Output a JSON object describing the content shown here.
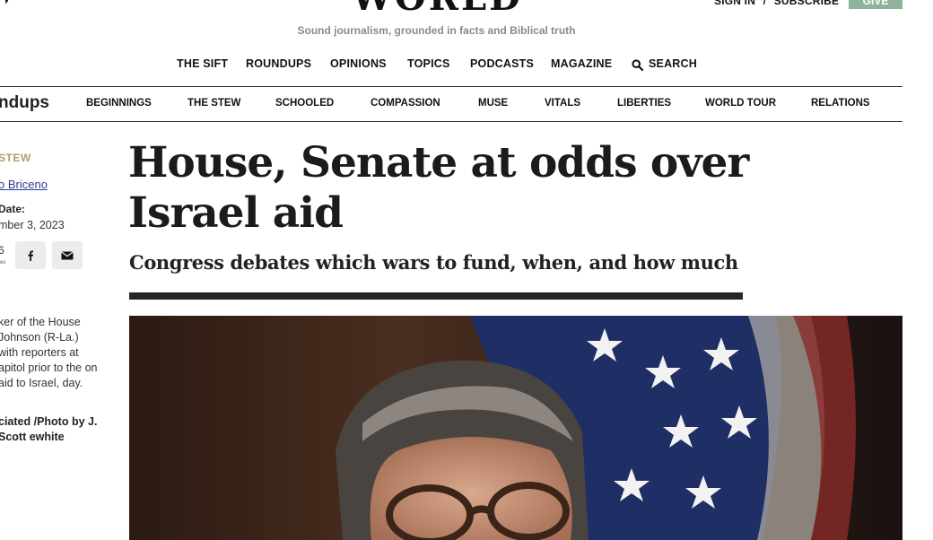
{
  "header": {
    "logo_text": "WORLD",
    "tagline": "Sound journalism, grounded in facts and Biblical truth",
    "sign_in": "SIGN IN",
    "separator": "/",
    "subscribe": "SUBSCRIBE",
    "give": "GIVE",
    "give_color": "#8fb29b"
  },
  "main_nav": [
    {
      "label": "THE SIFT"
    },
    {
      "label": "ROUNDUPS"
    },
    {
      "label": "OPINIONS"
    },
    {
      "label": "TOPICS"
    },
    {
      "label": "PODCASTS"
    },
    {
      "label": "MAGAZINE"
    },
    {
      "label": "SEARCH",
      "icon": "search-icon"
    }
  ],
  "sub_nav": {
    "brand": "ndups",
    "items": [
      {
        "label": "BEGINNINGS"
      },
      {
        "label": "THE STEW"
      },
      {
        "label": "SCHOOLED"
      },
      {
        "label": "COMPASSION"
      },
      {
        "label": "MUSE"
      },
      {
        "label": "VITALS"
      },
      {
        "label": "LIBERTIES"
      },
      {
        "label": "WORLD TOUR"
      },
      {
        "label": "RELATIONS"
      }
    ]
  },
  "sidebar": {
    "kicker": "STEW",
    "author": "o Briceno",
    "date_label": "Date:",
    "date_value": "mber 3, 2023",
    "share_count": "6",
    "share_label": "res",
    "caption": "ker of the House Johnson (R-La.) with reporters at apitol prior to the on aid to Israel, day.",
    "credit": "ciated /Photo by J. Scott ewhite",
    "share_buttons": [
      {
        "icon": "facebook-icon"
      },
      {
        "icon": "email-icon"
      }
    ]
  },
  "article": {
    "headline": "House, Senate at odds over Israel aid",
    "dek": "Congress debates which wars to fund, when, and how much",
    "rule_color": "#222629"
  },
  "colors": {
    "kicker": "#b79a6a",
    "author_link": "#2b3a8f",
    "tagline": "#8a8a8a"
  }
}
